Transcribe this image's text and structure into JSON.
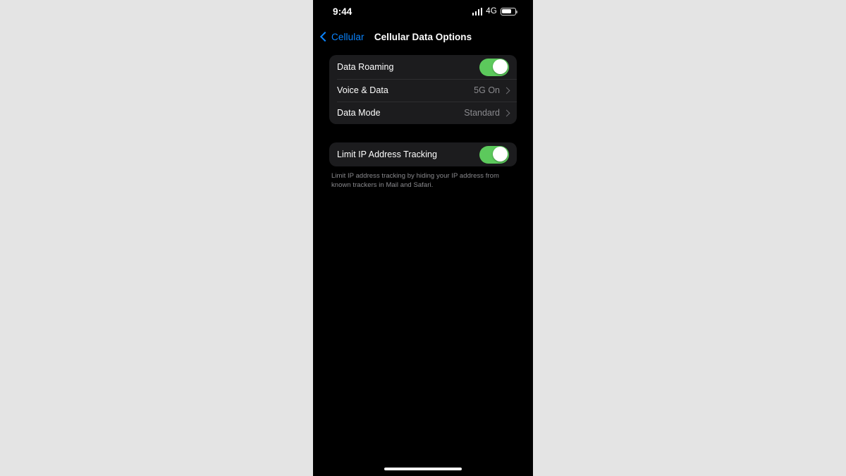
{
  "status_bar": {
    "time": "9:44",
    "network_label": "4G",
    "signal_icon": "signal-bars-icon",
    "battery_icon": "battery-icon"
  },
  "nav": {
    "back_label": "Cellular",
    "back_icon": "chevron-left-icon",
    "title": "Cellular Data Options"
  },
  "groups": [
    {
      "rows": [
        {
          "label": "Data Roaming",
          "type": "toggle",
          "value": "On"
        },
        {
          "label": "Voice & Data",
          "type": "disclosure",
          "value": "5G On"
        },
        {
          "label": "Data Mode",
          "type": "disclosure",
          "value": "Standard"
        }
      ]
    },
    {
      "rows": [
        {
          "label": "Limit IP Address Tracking",
          "type": "toggle",
          "value": "On"
        }
      ],
      "footer": "Limit IP address tracking by hiding your IP address from known trackers in Mail and Safari."
    }
  ],
  "colors": {
    "accent_blue": "#0a84ff",
    "toggle_on_green": "#5cc95c",
    "row_background": "#1c1c1e",
    "screen_background": "#000000",
    "page_background": "#e4e4e4",
    "secondary_text": "#8a8a8e"
  },
  "home_indicator": "home-indicator"
}
